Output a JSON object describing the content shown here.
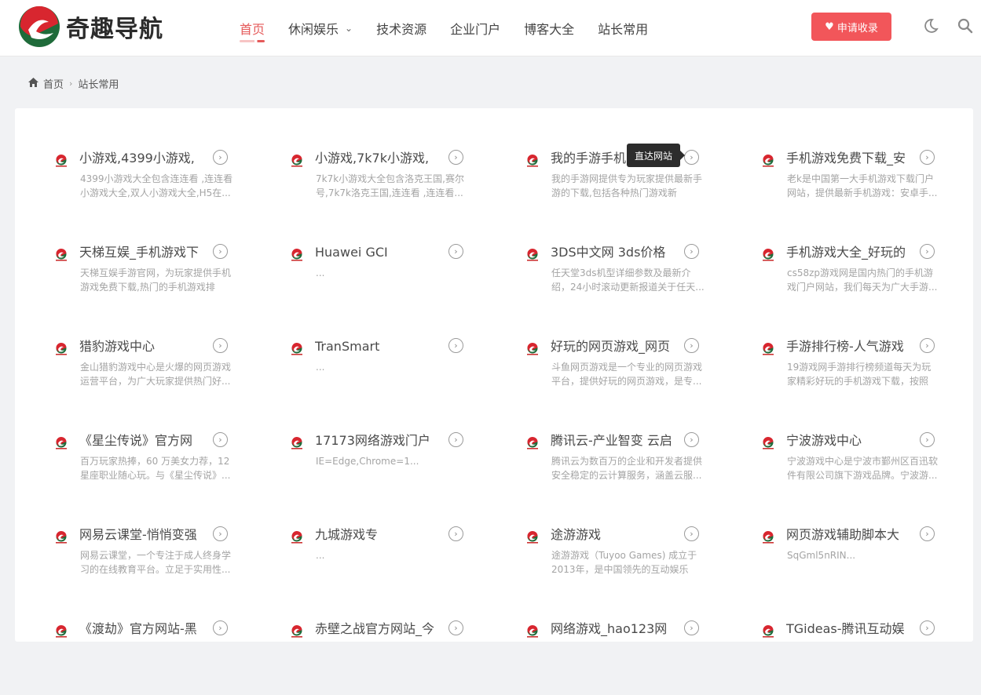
{
  "header": {
    "site_name": "奇趣导航",
    "nav": [
      {
        "label": "首页",
        "active": true
      },
      {
        "label": "休闲娱乐",
        "has_dropdown": true
      },
      {
        "label": "技术资源"
      },
      {
        "label": "企业门户"
      },
      {
        "label": "博客大全"
      },
      {
        "label": "站长常用"
      }
    ],
    "apply_label": "申请收录"
  },
  "breadcrumb": {
    "home": "首页",
    "current": "站长常用"
  },
  "tooltip": "直达网站",
  "accent_color": "#f2565a",
  "sites": [
    {
      "title": "小游戏,4399小游戏,",
      "desc": "4399小游戏大全包含连连看 ,连连看小游戏大全,双人小游戏大全,H5在..."
    },
    {
      "title": "小游戏,7k7k小游戏,",
      "desc": "7k7k小游戏大全包含洛克王国,赛尔号,7k7k洛克王国,连连看 ,连连看..."
    },
    {
      "title": "我的手游手机",
      "desc": "我的手游网提供专为玩家提供最新手游的下载,包括各种热门游戏新闻、..."
    },
    {
      "title": "手机游戏免费下载_安",
      "desc": "老k是中国第一大手机游戏下载门户网站，提供最新手机游戏：安卓手..."
    },
    {
      "title": "天梯互娱_手机游戏下",
      "desc": "天梯互娱手游官网，为玩家提供手机游戏免费下载,热门的手机游戏排行..."
    },
    {
      "title": "Huawei GCI",
      "desc": "..."
    },
    {
      "title": "3DS中文网 3ds价格",
      "desc": "任天堂3ds机型详细参数及最新介绍，24小时滚动更新报道关于任天..."
    },
    {
      "title": "手机游戏大全_好玩的",
      "desc": "cs58zp游戏网是国内热门的手机游戏门户网站，我们每天为广大手游..."
    },
    {
      "title": "猎豹游戏中心",
      "desc": "金山猎豹游戏中心是火爆的网页游戏运营平台，为广大玩家提供热门好..."
    },
    {
      "title": "TranSmart",
      "desc": "..."
    },
    {
      "title": "好玩的网页游戏_网页",
      "desc": "斗鱼网页游戏是一个专业的网页游戏平台，提供好玩的网页游戏，是专..."
    },
    {
      "title": "手游排行榜-人气游戏",
      "desc": "19游戏网手游排行榜频道每天为玩家精彩好玩的手机游戏下载，按照玩..."
    },
    {
      "title": "《星尘传说》官方网",
      "desc": "百万玩家热捧，60 万美女力荐，12 星座职业随心玩。与《星尘传说》..."
    },
    {
      "title": "17173网络游戏门户",
      "desc": "IE=Edge,Chrome=1..."
    },
    {
      "title": "腾讯云-产业智变 云启",
      "desc": "腾讯云为数百万的企业和开发者提供安全稳定的云计算服务，涵盖云服..."
    },
    {
      "title": "宁波游戏中心",
      "desc": "宁波游戏中心是宁波市鄞州区百迅软件有限公司旗下游戏品牌。宁波游..."
    },
    {
      "title": "网易云课堂-悄悄变强",
      "desc": "网易云课堂，一个专注于成人终身学习的在线教育平台。立足于实用性..."
    },
    {
      "title": "九城游戏专",
      "desc": "..."
    },
    {
      "title": "途游游戏",
      "desc": "途游游戏（Tuyoo Games) 成立于 2013年，是中国领先的互动娱乐供..."
    },
    {
      "title": "网页游戏辅助脚本大",
      "desc": "SqGml5nRIN..."
    },
    {
      "title": "《渡劫》官方网站-黑",
      "desc": ""
    },
    {
      "title": "赤壁之战官方网站_今",
      "desc": ""
    },
    {
      "title": "网络游戏_hao123网",
      "desc": ""
    },
    {
      "title": "TGideas-腾讯互动娱",
      "desc": ""
    }
  ]
}
